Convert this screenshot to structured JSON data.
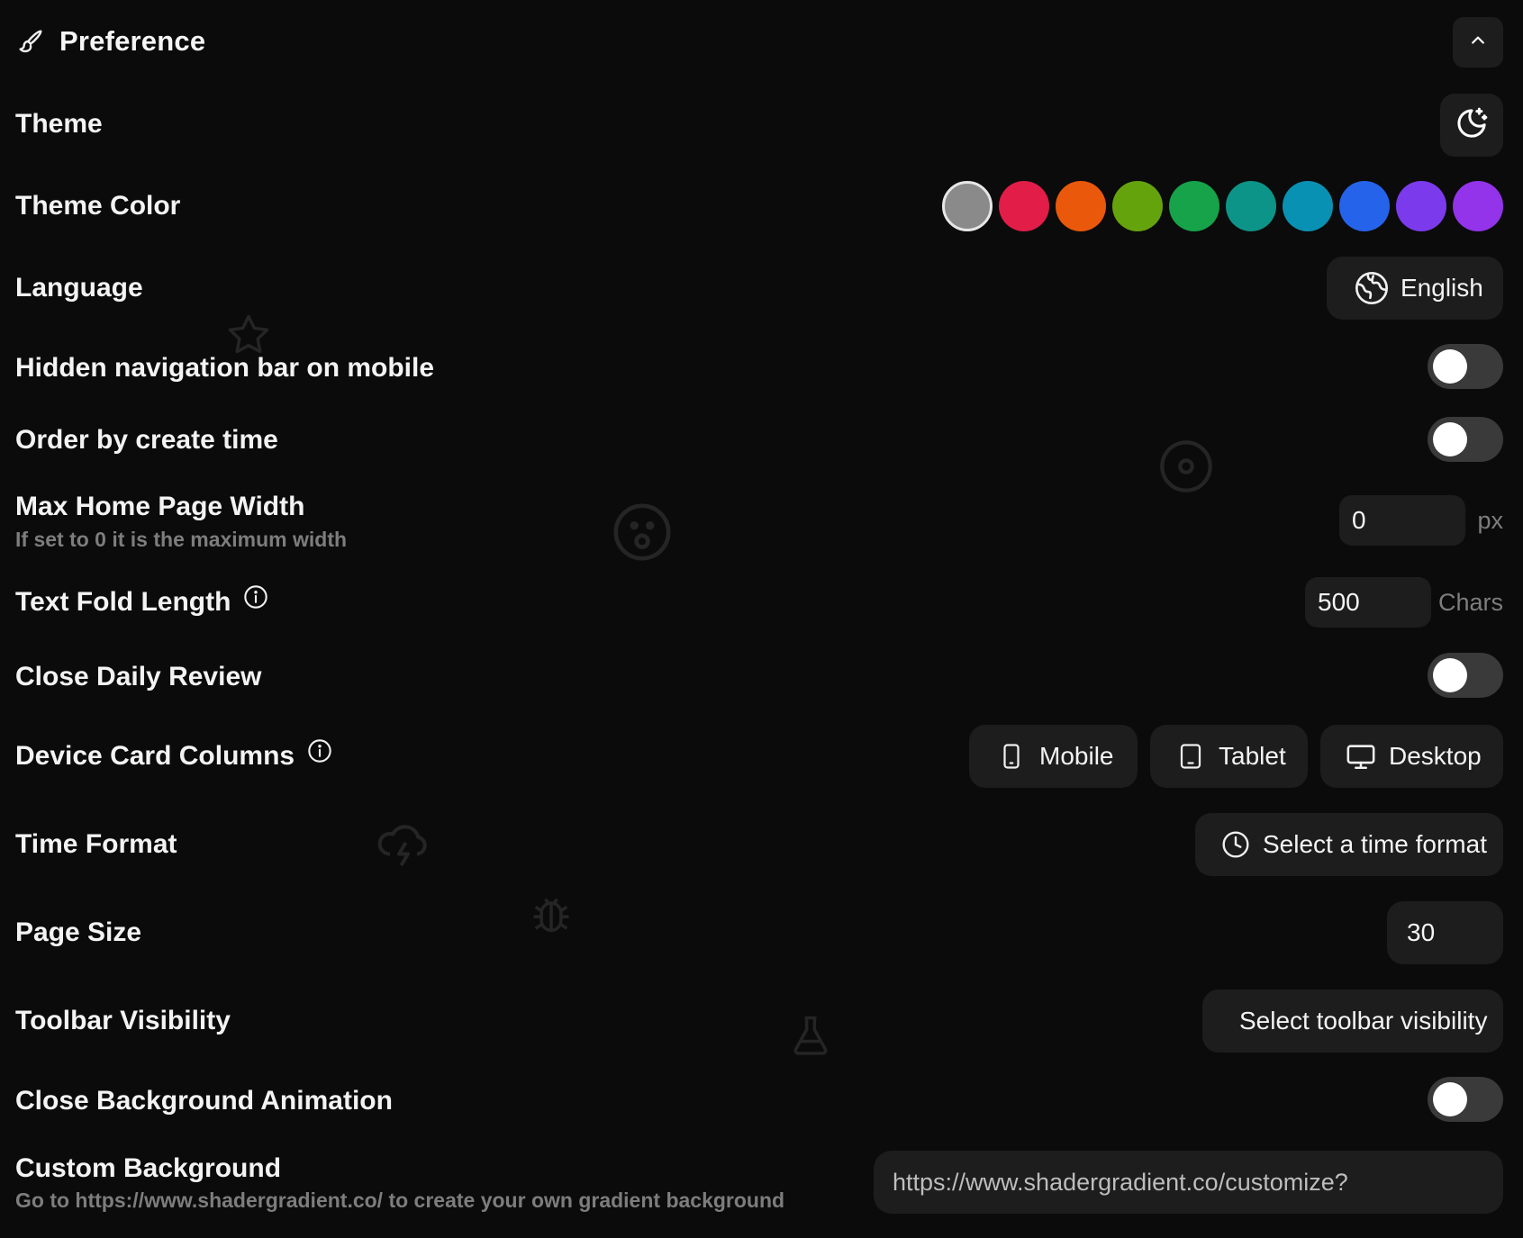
{
  "header": {
    "title": "Preference",
    "brush_icon": "paint-brush-icon",
    "collapse_icon": "chevron-up-icon"
  },
  "theme": {
    "label": "Theme",
    "icon": "moon-stars-icon"
  },
  "theme_color": {
    "label": "Theme Color",
    "colors": [
      "#8a8a8a",
      "#e11d48",
      "#ea580c",
      "#65a30d",
      "#16a34a",
      "#0d9488",
      "#0891b2",
      "#2563eb",
      "#7c3aed",
      "#9333ea"
    ],
    "selected_index": 0
  },
  "language": {
    "label": "Language",
    "value": "English",
    "icon": "globe-icon"
  },
  "hidden_nav": {
    "label": "Hidden navigation bar on mobile",
    "enabled": false
  },
  "order_by_create_time": {
    "label": "Order by create time",
    "enabled": false
  },
  "max_home_page_width": {
    "label": "Max Home Page Width",
    "hint": "If set to 0 it is the maximum width",
    "value": "0",
    "unit": "px"
  },
  "text_fold_length": {
    "label": "Text Fold Length",
    "value": "500",
    "unit": "Chars",
    "info_icon": "info-icon"
  },
  "close_daily_review": {
    "label": "Close Daily Review",
    "enabled": false
  },
  "device_card_columns": {
    "label": "Device Card Columns",
    "info_icon": "info-icon",
    "buttons": [
      {
        "label": "Mobile",
        "icon": "smartphone-icon"
      },
      {
        "label": "Tablet",
        "icon": "tablet-icon"
      },
      {
        "label": "Desktop",
        "icon": "monitor-icon"
      }
    ]
  },
  "time_format": {
    "label": "Time Format",
    "placeholder": "Select a time format",
    "icon": "clock-icon"
  },
  "page_size": {
    "label": "Page Size",
    "value": "30"
  },
  "toolbar_visibility": {
    "label": "Toolbar Visibility",
    "placeholder": "Select toolbar visibility"
  },
  "close_background_animation": {
    "label": "Close Background Animation",
    "enabled": false
  },
  "custom_background": {
    "label": "Custom Background",
    "hint": "Go to https://www.shadergradient.co/ to create your own gradient background",
    "value": "https://www.shadergradient.co/customize?"
  }
}
